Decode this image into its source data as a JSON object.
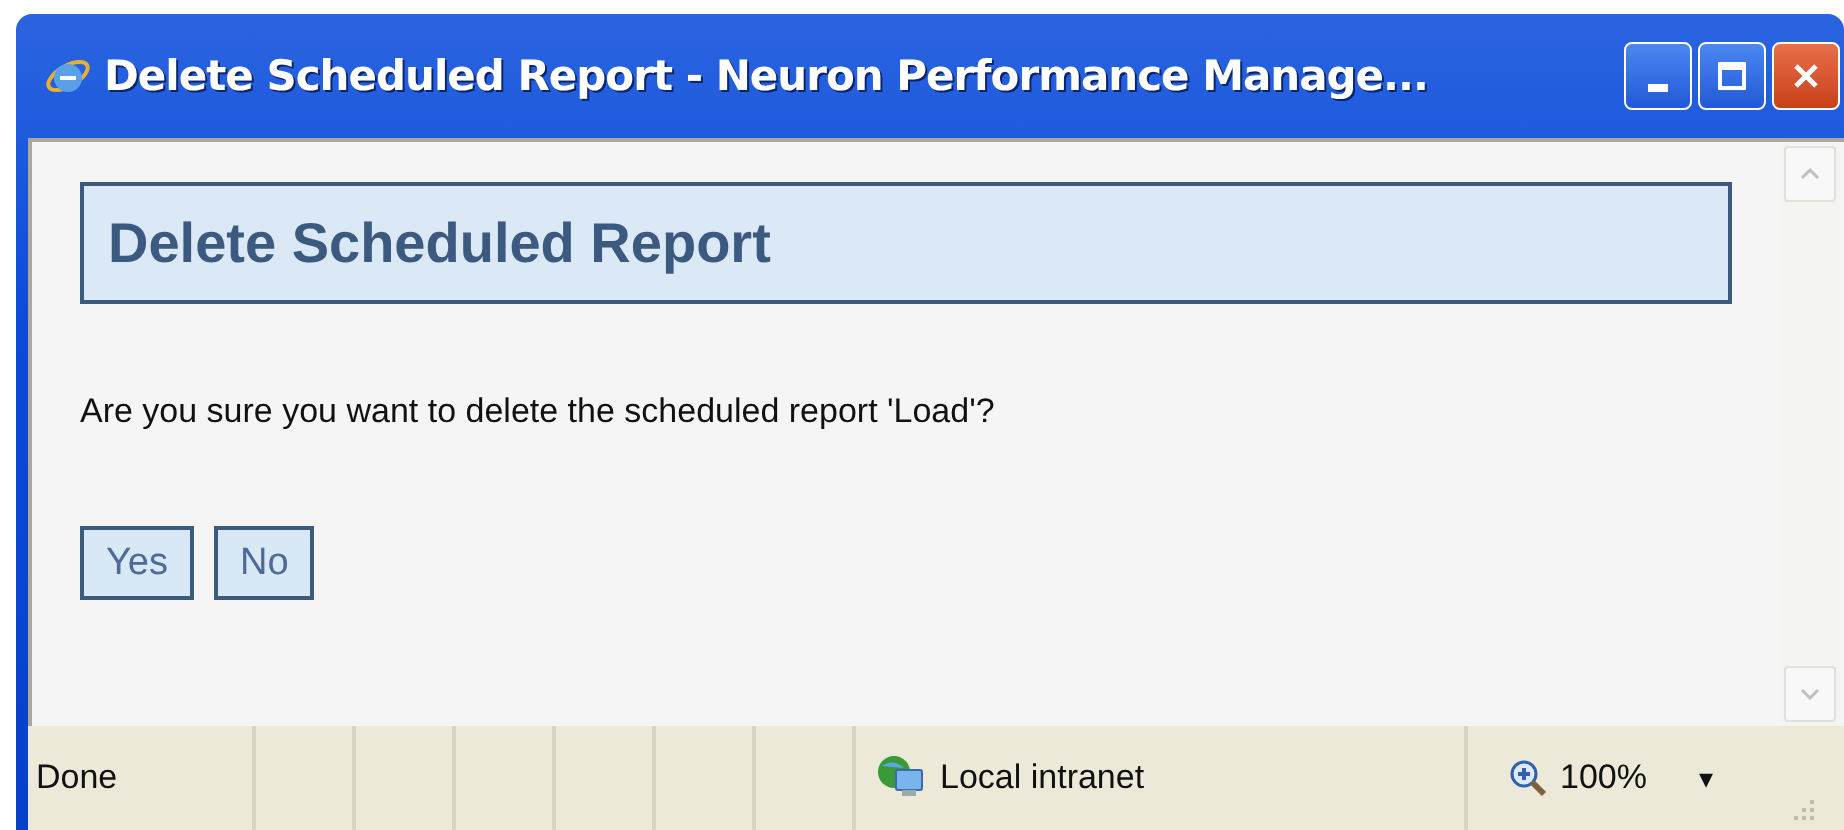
{
  "window": {
    "title": "Delete Scheduled Report - Neuron Performance Manage..."
  },
  "dialog": {
    "heading": "Delete Scheduled Report",
    "message": "Are you sure you want to delete the scheduled report 'Load'?",
    "buttons": [
      "Yes",
      "No"
    ]
  },
  "status_bar": {
    "status": "Done",
    "zone": "Local intranet",
    "zoom": "100%",
    "zoom_menu": "▾"
  }
}
